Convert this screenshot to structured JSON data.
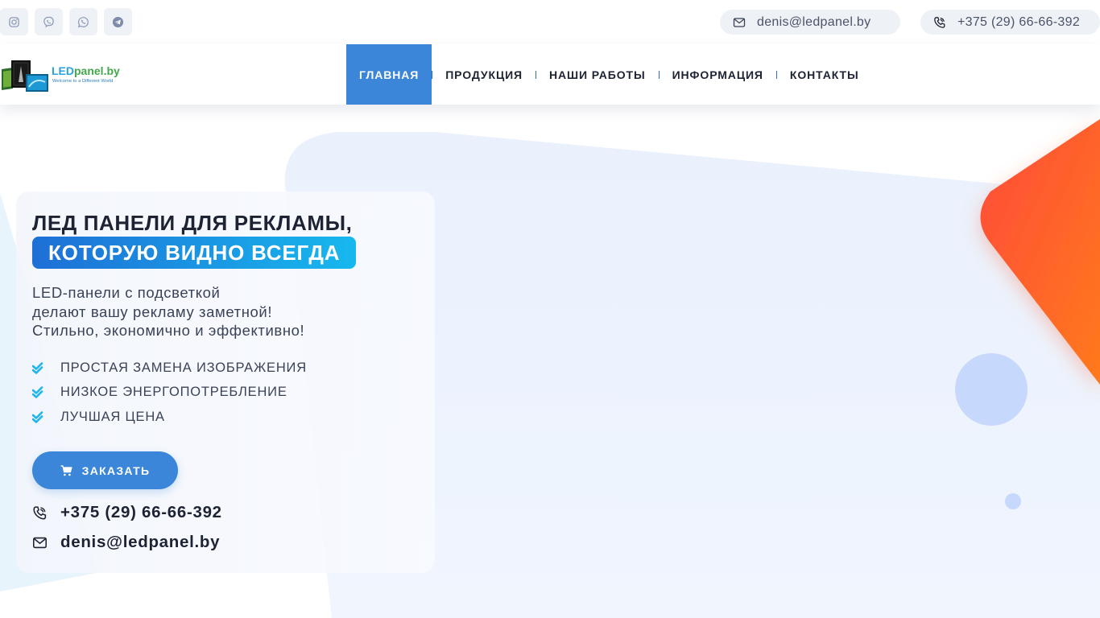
{
  "topbar": {
    "social": [
      {
        "name": "instagram",
        "icon": "instagram-icon"
      },
      {
        "name": "viber",
        "icon": "viber-icon"
      },
      {
        "name": "whatsapp",
        "icon": "whatsapp-icon"
      },
      {
        "name": "telegram",
        "icon": "telegram-icon"
      }
    ],
    "email": "denis@ledpanel.by",
    "phone": "+375 (29) 66-66-392"
  },
  "header": {
    "logo_text": "LEDpanel.by",
    "logo_tagline": "Welcome to a Different World",
    "nav": [
      {
        "label": "ГЛАВНАЯ",
        "active": true
      },
      {
        "label": "ПРОДУКЦИЯ",
        "active": false
      },
      {
        "label": "НАШИ РАБОТЫ",
        "active": false
      },
      {
        "label": "ИНФОРМАЦИЯ",
        "active": false
      },
      {
        "label": "КОНТАКТЫ",
        "active": false
      }
    ]
  },
  "hero": {
    "title_line1": "ЛЕД ПАНЕЛИ ДЛЯ РЕКЛАМЫ,",
    "title_line2": "КОТОРУЮ ВИДНО ВСЕГДА",
    "desc_lines": [
      "LED-панели с подсветкой",
      "делают вашу рекламу заметной!",
      "Стильно, экономично и эффективно!"
    ],
    "features": [
      "ПРОСТАЯ ЗАМЕНА ИЗОБРАЖЕНИЯ",
      "НИЗКОЕ ЭНЕРГОПОТРЕБЛЕНИЕ",
      "ЛУЧШАЯ ЦЕНА"
    ],
    "order_label": "ЗАКАЗАТЬ",
    "phone": "+375 (29) 66-66-392",
    "email": "denis@ledpanel.by"
  },
  "colors": {
    "accent": "#3b86d8",
    "gradient_start": "#1e6fd6",
    "gradient_end": "#17b8ee",
    "check": "#1fb4ea",
    "orange": "#ff5a2c"
  }
}
